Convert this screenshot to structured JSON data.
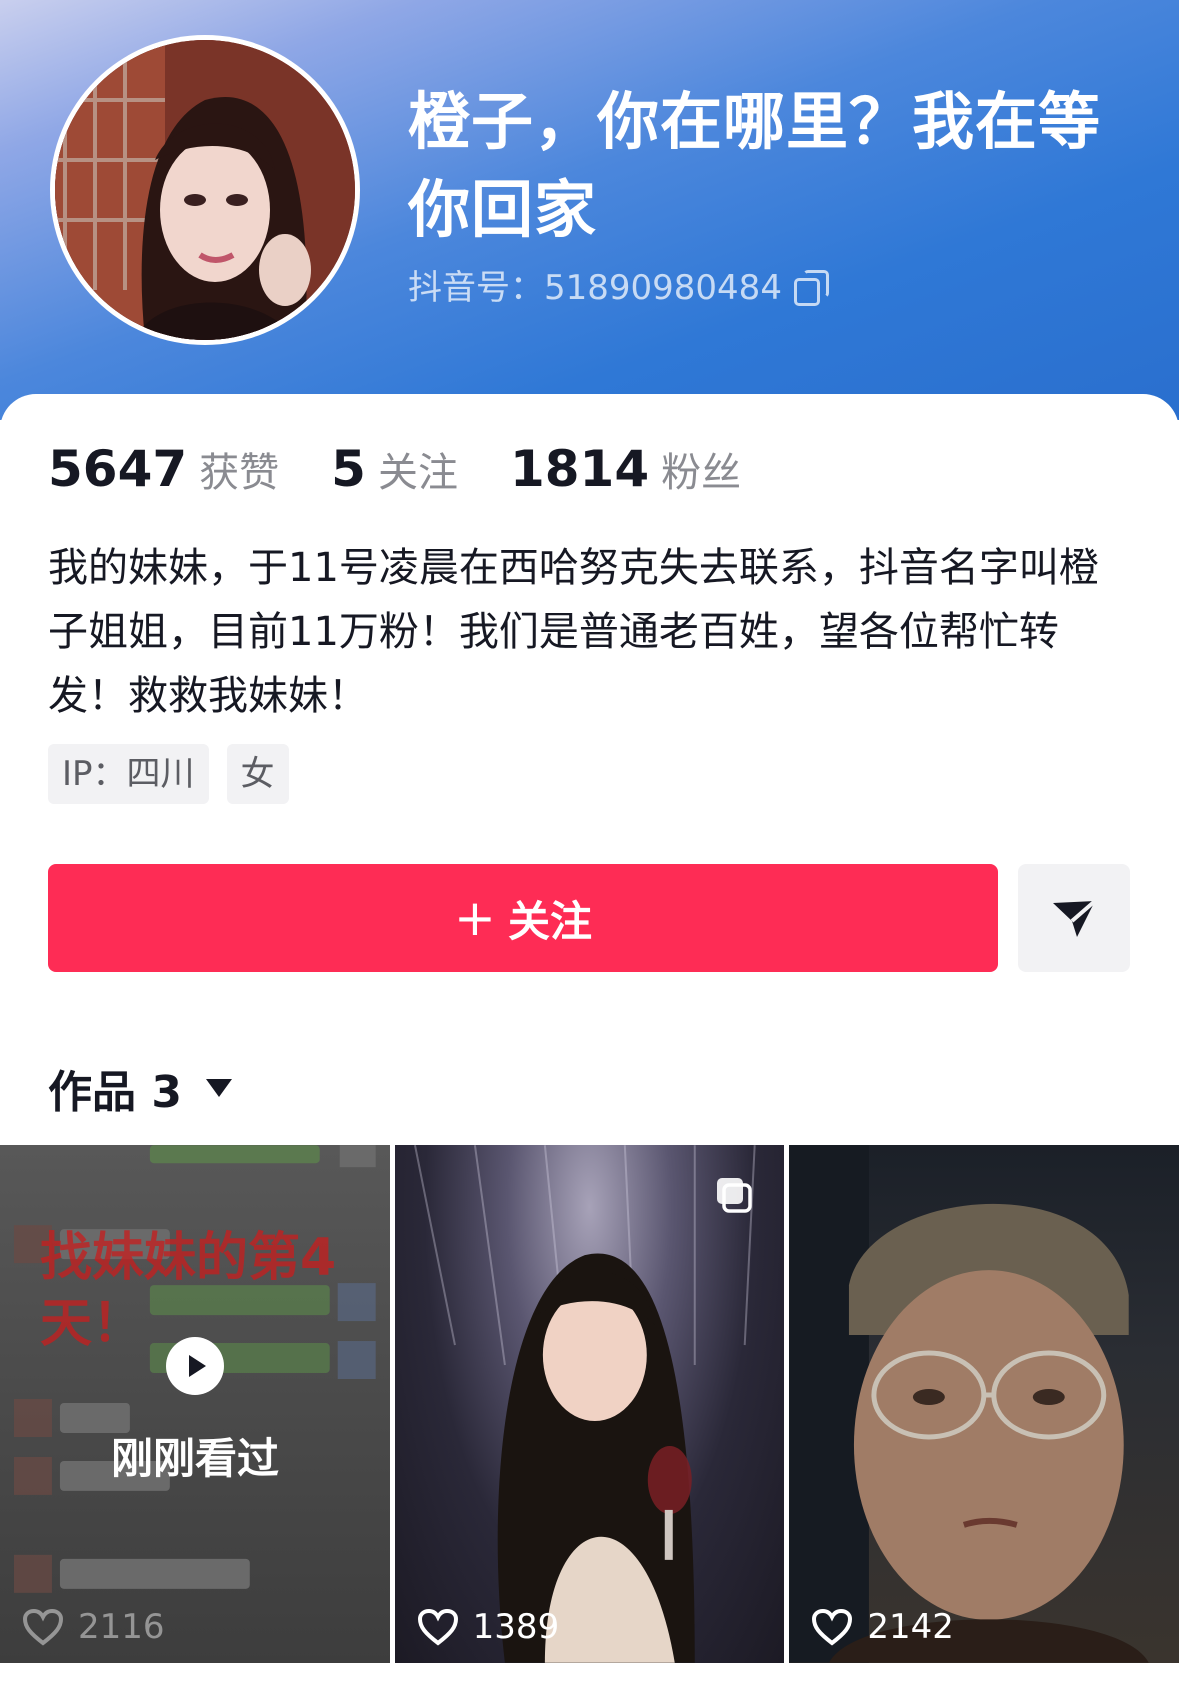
{
  "profile": {
    "nickname": "橙子，你在哪里？我在等你回家",
    "douyin_id": "抖音号：51890980484",
    "bio": "我的妹妹，于11号凌晨在西哈努克失去联系，抖音名字叫橙子姐姐，目前11万粉！我们是普通老百姓，望各位帮忙转发！救救我妹妹！",
    "tags": [
      {
        "label": "IP：四川"
      },
      {
        "label": "女"
      }
    ]
  },
  "stats": [
    {
      "value": "5647",
      "label": "获赞"
    },
    {
      "value": "5",
      "label": "关注"
    },
    {
      "value": "1814",
      "label": "粉丝"
    }
  ],
  "actions": {
    "follow_label": "关注",
    "follow_icon": "plus-icon",
    "share_icon": "send-icon"
  },
  "works": {
    "label": "作品 3",
    "items": [
      {
        "overlay_title": "找妹妹的第4天！",
        "seen_label": "刚刚看过",
        "likes": "2116",
        "icon": "play-icon"
      },
      {
        "likes": "1389",
        "icon": "multi-image-icon"
      },
      {
        "likes": "2142"
      }
    ]
  },
  "colors": {
    "accent": "#fe2c55",
    "header_gradient": [
      "#c9cfee",
      "#4c87dc",
      "#2a6fce"
    ],
    "text_primary": "#161823",
    "text_secondary": "#8a8b91"
  }
}
